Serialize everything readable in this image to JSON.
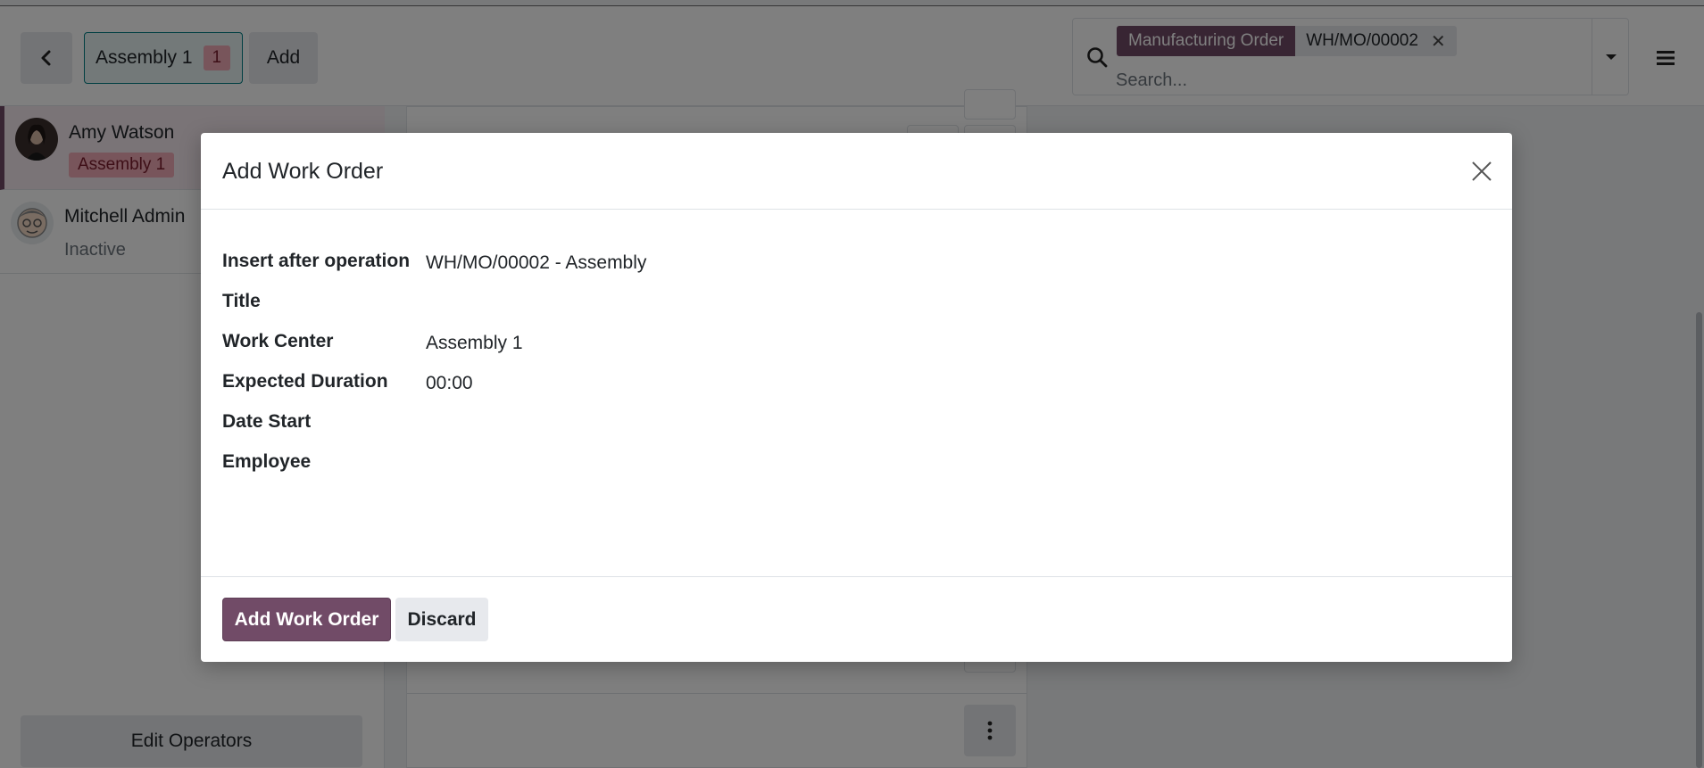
{
  "colors": {
    "brand": "#714b67",
    "accent_teal": "#017e84",
    "badge_pink": "#f0aab6"
  },
  "topbar": {
    "back_icon": "chevron-left-icon",
    "workcenter_label": "Assembly 1",
    "workcenter_count": "1",
    "add_label": "Add"
  },
  "search": {
    "facet_label": "Manufacturing Order",
    "facet_value": "WH/MO/00002",
    "facet_remove_icon": "close-icon",
    "placeholder": "Search..."
  },
  "sidebar": {
    "operators": [
      {
        "name": "Amy Watson",
        "badge": "Assembly 1",
        "status": ""
      },
      {
        "name": "Mitchell Admin",
        "badge": "",
        "status": "Inactive"
      }
    ],
    "edit_label": "Edit Operators"
  },
  "dialog": {
    "title": "Add Work Order",
    "fields": [
      {
        "label": "Insert after operation",
        "value": "WH/MO/00002 - Assembly"
      },
      {
        "label": "Title",
        "value": ""
      },
      {
        "label": "Work Center",
        "value": "Assembly 1"
      },
      {
        "label": "Expected Duration",
        "value": "00:00"
      },
      {
        "label": "Date Start",
        "value": ""
      },
      {
        "label": "Employee",
        "value": ""
      }
    ],
    "primary_label": "Add Work Order",
    "secondary_label": "Discard"
  }
}
